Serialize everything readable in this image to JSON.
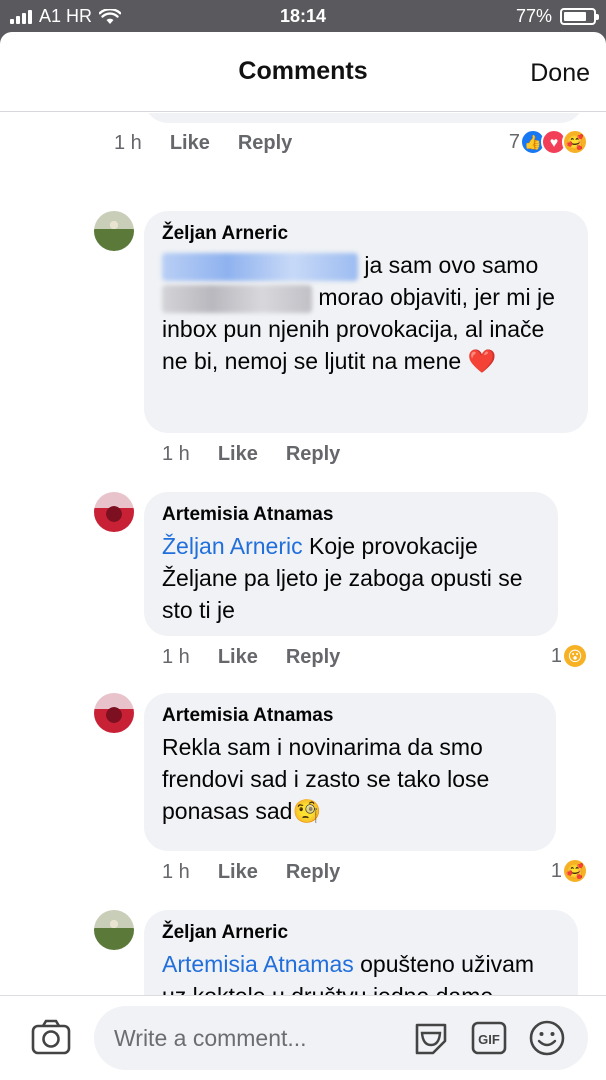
{
  "status_bar": {
    "carrier": "A1 HR",
    "time": "18:14",
    "battery": "77%"
  },
  "header": {
    "title": "Comments",
    "done_label": "Done"
  },
  "meta_labels": {
    "like": "Like",
    "reply": "Reply"
  },
  "previous_comment": {
    "time": "1 h",
    "reaction_count": "7",
    "reactions": [
      "like-icon",
      "love-icon",
      "care-icon"
    ]
  },
  "comments": [
    {
      "author": "Željan Arneric",
      "text_part1": "ja sam ovo samo",
      "text_part2": "morao objaviti, jer mi je inbox pun njenih provokacija, al inače ne bi, nemoj se ljutit na mene",
      "emoji": "❤️",
      "time": "1 h"
    },
    {
      "author": "Artemisia Atnamas",
      "mention": "Željan Arneric",
      "text": "Koje provokacije Željane pa ljeto je zaboga opusti se sto ti je",
      "time": "1 h",
      "reaction_count": "1",
      "reactions": [
        "wow-icon"
      ]
    },
    {
      "author": "Artemisia Atnamas",
      "text": "Rekla sam i novinarima da smo frendovi sad i zasto se tako lose ponasas sad",
      "emoji": "🧐",
      "time": "1 h",
      "reaction_count": "1",
      "reactions": [
        "care-icon"
      ]
    },
    {
      "author": "Željan Arneric",
      "mention": "Artemisia Atnamas",
      "text": "opušteno uživam uz koktele u društvu jedne dame",
      "partial_last_line": "dama"
    }
  ],
  "composer": {
    "placeholder": "Write a comment..."
  },
  "colors": {
    "mention": "#216fdb",
    "bubble": "#f0f2f5",
    "meta": "#65676b",
    "like": "#1877f2",
    "love": "#f33e58",
    "care": "#f7b125"
  }
}
